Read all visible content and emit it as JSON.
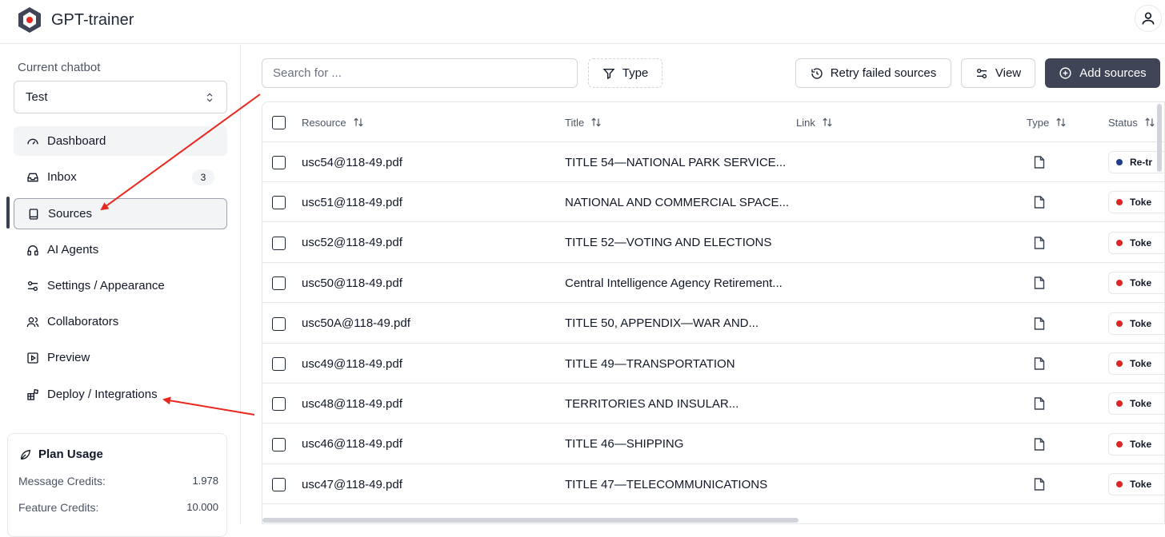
{
  "app": {
    "title": "GPT-trainer"
  },
  "sidebar": {
    "current_label": "Current chatbot",
    "selected_bot": "Test",
    "items": [
      {
        "label": "Dashboard",
        "icon": "gauge-icon"
      },
      {
        "label": "Inbox",
        "icon": "inbox-icon",
        "badge": "3"
      },
      {
        "label": "Sources",
        "icon": "book-icon",
        "active": true
      },
      {
        "label": "AI Agents",
        "icon": "headphones-icon"
      },
      {
        "label": "Settings / Appearance",
        "icon": "sliders-icon"
      },
      {
        "label": "Collaborators",
        "icon": "users-icon"
      },
      {
        "label": "Preview",
        "icon": "play-square-icon"
      },
      {
        "label": "Deploy / Integrations",
        "icon": "blocks-icon"
      }
    ],
    "plan": {
      "title": "Plan Usage",
      "rows": [
        {
          "label": "Message Credits:",
          "value": "1.978"
        },
        {
          "label": "Feature Credits:",
          "value": "10.000"
        }
      ]
    }
  },
  "toolbar": {
    "search_placeholder": "Search for ...",
    "type_label": "Type",
    "retry_label": "Retry failed sources",
    "view_label": "View",
    "add_label": "Add sources"
  },
  "table": {
    "columns": [
      "Resource",
      "Title",
      "Link",
      "Type",
      "Status"
    ],
    "rows": [
      {
        "resource": "usc54@118-49.pdf",
        "title": "TITLE 54—NATIONAL PARK SERVICE...",
        "status": "Re-tr",
        "status_color": "#1e3a8a"
      },
      {
        "resource": "usc51@118-49.pdf",
        "title": "NATIONAL AND COMMERCIAL SPACE...",
        "status": "Toke",
        "status_color": "#dc2626"
      },
      {
        "resource": "usc52@118-49.pdf",
        "title": "TITLE 52—VOTING AND ELECTIONS",
        "status": "Toke",
        "status_color": "#dc2626"
      },
      {
        "resource": "usc50@118-49.pdf",
        "title": "Central Intelligence Agency Retirement...",
        "status": "Toke",
        "status_color": "#dc2626"
      },
      {
        "resource": "usc50A@118-49.pdf",
        "title": "TITLE 50, APPENDIX—WAR AND...",
        "status": "Toke",
        "status_color": "#dc2626"
      },
      {
        "resource": "usc49@118-49.pdf",
        "title": "TITLE 49—TRANSPORTATION",
        "status": "Toke",
        "status_color": "#dc2626"
      },
      {
        "resource": "usc48@118-49.pdf",
        "title": "TERRITORIES AND INSULAR...",
        "status": "Toke",
        "status_color": "#dc2626"
      },
      {
        "resource": "usc46@118-49.pdf",
        "title": "TITLE 46—SHIPPING",
        "status": "Toke",
        "status_color": "#dc2626"
      },
      {
        "resource": "usc47@118-49.pdf",
        "title": "TITLE 47—TELECOMMUNICATIONS",
        "status": "Toke",
        "status_color": "#dc2626"
      }
    ]
  },
  "colors": {
    "primary_button": "#3f4457",
    "annotation_arrow": "#e8281f"
  }
}
